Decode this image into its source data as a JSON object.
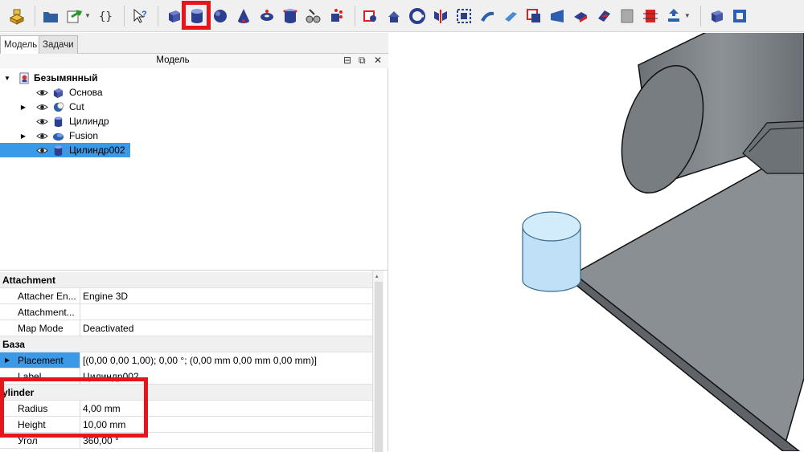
{
  "tabs": [
    {
      "label": "Модель"
    },
    {
      "label": "Задачи"
    }
  ],
  "panel_title": "Модель",
  "tree": {
    "root": "Безымянный",
    "items": [
      {
        "label": "Основа",
        "icon": "box-icon"
      },
      {
        "label": "Cut",
        "icon": "cut-icon"
      },
      {
        "label": "Цилиндр",
        "icon": "cylinder-icon"
      },
      {
        "label": "Fusion",
        "icon": "fusion-icon"
      },
      {
        "label": "Цилиндр002",
        "icon": "cylinder-icon"
      }
    ]
  },
  "properties": {
    "group_attachment": "Attachment",
    "attacher_engine": {
      "name": "Attacher En...",
      "value": "Engine 3D"
    },
    "attachment": {
      "name": "Attachment...",
      "value": ""
    },
    "map_mode": {
      "name": "Map Mode",
      "value": "Deactivated"
    },
    "group_base": "База",
    "placement": {
      "name": "Placement",
      "value": "[(0,00 0,00 1,00); 0,00 °; (0,00 mm  0,00 mm  0,00 mm)]"
    },
    "label": {
      "name": "Label",
      "value": "Цилиндр002"
    },
    "group_cylinder": "ylinder",
    "radius": {
      "name": "Radius",
      "value": "4,00 mm"
    },
    "height": {
      "name": "Height",
      "value": "10,00 mm"
    },
    "angle": {
      "name": "Угол",
      "value": "360,00 °"
    }
  },
  "colors": {
    "highlight": "#e8141c",
    "selection": "#3b9ae8"
  }
}
